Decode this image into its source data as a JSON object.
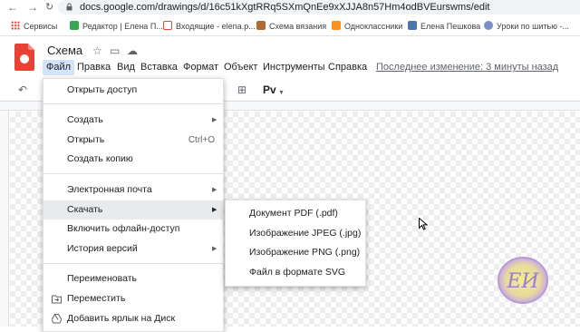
{
  "browser": {
    "url": "docs.google.com/drawings/d/16c51kXgtRRq5SXmQnEe9xXJJA8n57Hm4odBVEurswms/edit",
    "back_icon": "arrow-left-icon",
    "forward_icon": "arrow-right-icon",
    "reload_icon": "reload-icon",
    "bookmarks": [
      {
        "label": "Сервисы",
        "icon": "apps-grid-icon",
        "color": "#4285f4"
      },
      {
        "label": "Редактор | Елена П...",
        "icon": "green-square-icon",
        "color": "#34a853"
      },
      {
        "label": "Входящие - elena.p...",
        "icon": "gmail-icon",
        "color": "#ea4335"
      },
      {
        "label": "Схема вязания",
        "icon": "bookmark-image-icon",
        "color": "#b06a36"
      },
      {
        "label": "Одноклассники",
        "icon": "odnoklassniki-icon",
        "color": "#f7931e"
      },
      {
        "label": "Елена Пешкова",
        "icon": "vk-icon",
        "color": "#4a76a8"
      },
      {
        "label": "Уроки по шитью -...",
        "icon": "site-icon",
        "color": "#7b8ec8"
      }
    ]
  },
  "app": {
    "title": "Схема",
    "logo_color": "#e94235",
    "menus": [
      "Файл",
      "Правка",
      "Вид",
      "Вставка",
      "Формат",
      "Объект",
      "Инструменты",
      "Справка"
    ],
    "last_edit": "Последнее изменение: 3 минуты назад"
  },
  "file_menu": {
    "items": [
      {
        "label": "Открыть доступ",
        "shortcut": "",
        "submenu": false
      },
      {
        "label": "Создать",
        "shortcut": "",
        "submenu": true
      },
      {
        "label": "Открыть",
        "shortcut": "Ctrl+O",
        "submenu": false
      },
      {
        "label": "Создать копию",
        "shortcut": "",
        "submenu": false
      },
      {
        "label": "Электронная почта",
        "shortcut": "",
        "submenu": true
      },
      {
        "label": "Скачать",
        "shortcut": "",
        "submenu": true,
        "highlighted": true
      },
      {
        "label": "Включить офлайн-доступ",
        "shortcut": "",
        "submenu": false
      },
      {
        "label": "История версий",
        "shortcut": "",
        "submenu": true
      },
      {
        "label": "Переименовать",
        "shortcut": "",
        "submenu": false
      },
      {
        "label": "Переместить",
        "shortcut": "",
        "submenu": false,
        "icon": "move-folder-icon"
      },
      {
        "label": "Добавить ярлык на Диск",
        "shortcut": "",
        "submenu": false,
        "icon": "drive-shortcut-icon"
      }
    ]
  },
  "download_menu": {
    "items": [
      "Документ PDF (.pdf)",
      "Изображение JPEG (.jpg)",
      "Изображение PNG (.png)",
      "Файл в формате SVG"
    ]
  },
  "watermark": {
    "text": "ЕИ"
  }
}
